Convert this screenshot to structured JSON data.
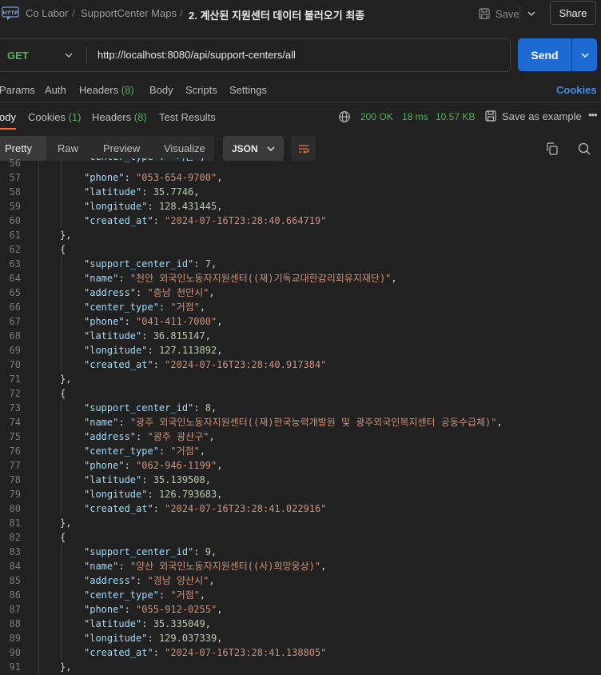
{
  "breadcrumb": {
    "workspace": "Co Labor",
    "collection": "SupportCenter Maps",
    "request": "2. 계산된 지원센터 데이터 불러오기 최종"
  },
  "header": {
    "save_label": "Save",
    "share_label": "Share"
  },
  "request": {
    "method": "GET",
    "url": "http://localhost:8080/api/support-centers/all",
    "send_label": "Send"
  },
  "request_tabs": {
    "params": "Params",
    "auth": "Auth",
    "headers": "Headers",
    "headers_count": "(8)",
    "body": "Body",
    "scripts": "Scripts",
    "settings": "Settings",
    "cookies": "Cookies"
  },
  "response_tabs": {
    "body": "ody",
    "cookies": "Cookies",
    "cookies_count": "(1)",
    "headers": "Headers",
    "headers_count": "(8)",
    "test_results": "Test Results"
  },
  "response_status": {
    "status": "200 OK",
    "time": "18 ms",
    "size": "10.57 KB",
    "save_example": "Save as example"
  },
  "format_tabs": {
    "pretty": "Pretty",
    "raw": "Raw",
    "preview": "Preview",
    "visualize": "Visualize",
    "format": "JSON"
  },
  "colors": {
    "accent": "#1d6ad3",
    "status_ok": "#53b25b",
    "tab_active": "#ff6c37",
    "cookies_link": "#3d8fe6"
  },
  "code_lines": [
    {
      "n": "56",
      "kind": "partial",
      "text": "\"center_type\": \"기관\","
    },
    {
      "n": "57",
      "kind": "kv",
      "key": "phone",
      "val": "\"053-654-9700\"",
      "vt": "s",
      "comma": ","
    },
    {
      "n": "58",
      "kind": "kv",
      "key": "latitude",
      "val": "35.7746",
      "vt": "n",
      "comma": ","
    },
    {
      "n": "59",
      "kind": "kv",
      "key": "longitude",
      "val": "128.431445",
      "vt": "n",
      "comma": ","
    },
    {
      "n": "60",
      "kind": "kv",
      "key": "created_at",
      "val": "\"2024-07-16T23:28:40.664719\"",
      "vt": "s",
      "comma": ""
    },
    {
      "n": "61",
      "kind": "close",
      "text": "},"
    },
    {
      "n": "62",
      "kind": "open",
      "text": "{"
    },
    {
      "n": "63",
      "kind": "kv",
      "key": "support_center_id",
      "val": "7",
      "vt": "n",
      "comma": ","
    },
    {
      "n": "64",
      "kind": "kv",
      "key": "name",
      "val": "\"천안 외국인노동자지원센터((재)기독교대한감리회유지재단)\"",
      "vt": "s",
      "comma": ","
    },
    {
      "n": "65",
      "kind": "kv",
      "key": "address",
      "val": "\"충남 천안시\"",
      "vt": "s",
      "comma": ","
    },
    {
      "n": "66",
      "kind": "kv",
      "key": "center_type",
      "val": "\"거점\"",
      "vt": "s",
      "comma": ","
    },
    {
      "n": "67",
      "kind": "kv",
      "key": "phone",
      "val": "\"041-411-7000\"",
      "vt": "s",
      "comma": ","
    },
    {
      "n": "68",
      "kind": "kv",
      "key": "latitude",
      "val": "36.815147",
      "vt": "n",
      "comma": ","
    },
    {
      "n": "69",
      "kind": "kv",
      "key": "longitude",
      "val": "127.113892",
      "vt": "n",
      "comma": ","
    },
    {
      "n": "70",
      "kind": "kv",
      "key": "created_at",
      "val": "\"2024-07-16T23:28:40.917384\"",
      "vt": "s",
      "comma": ""
    },
    {
      "n": "71",
      "kind": "close",
      "text": "},"
    },
    {
      "n": "72",
      "kind": "open",
      "text": "{"
    },
    {
      "n": "73",
      "kind": "kv",
      "key": "support_center_id",
      "val": "8",
      "vt": "n",
      "comma": ","
    },
    {
      "n": "74",
      "kind": "kv",
      "key": "name",
      "val": "\"광주 외국인노동자지원센터((재)한국능력개발원 및 광주외국인복지센터 공동수급체)\"",
      "vt": "s",
      "comma": ","
    },
    {
      "n": "75",
      "kind": "kv",
      "key": "address",
      "val": "\"광주 광산구\"",
      "vt": "s",
      "comma": ","
    },
    {
      "n": "76",
      "kind": "kv",
      "key": "center_type",
      "val": "\"거점\"",
      "vt": "s",
      "comma": ","
    },
    {
      "n": "77",
      "kind": "kv",
      "key": "phone",
      "val": "\"062-946-1199\"",
      "vt": "s",
      "comma": ","
    },
    {
      "n": "78",
      "kind": "kv",
      "key": "latitude",
      "val": "35.139508",
      "vt": "n",
      "comma": ","
    },
    {
      "n": "79",
      "kind": "kv",
      "key": "longitude",
      "val": "126.793683",
      "vt": "n",
      "comma": ","
    },
    {
      "n": "80",
      "kind": "kv",
      "key": "created_at",
      "val": "\"2024-07-16T23:28:41.022916\"",
      "vt": "s",
      "comma": ""
    },
    {
      "n": "81",
      "kind": "close",
      "text": "},"
    },
    {
      "n": "82",
      "kind": "open",
      "text": "{"
    },
    {
      "n": "83",
      "kind": "kv",
      "key": "support_center_id",
      "val": "9",
      "vt": "n",
      "comma": ","
    },
    {
      "n": "84",
      "kind": "kv",
      "key": "name",
      "val": "\"양산 외국인노동자지원센터((사)희망웅상)\"",
      "vt": "s",
      "comma": ","
    },
    {
      "n": "85",
      "kind": "kv",
      "key": "address",
      "val": "\"경남 양산시\"",
      "vt": "s",
      "comma": ","
    },
    {
      "n": "86",
      "kind": "kv",
      "key": "center_type",
      "val": "\"거점\"",
      "vt": "s",
      "comma": ","
    },
    {
      "n": "87",
      "kind": "kv",
      "key": "phone",
      "val": "\"055-912-0255\"",
      "vt": "s",
      "comma": ","
    },
    {
      "n": "88",
      "kind": "kv",
      "key": "latitude",
      "val": "35.335049",
      "vt": "n",
      "comma": ","
    },
    {
      "n": "89",
      "kind": "kv",
      "key": "longitude",
      "val": "129.037339",
      "vt": "n",
      "comma": ","
    },
    {
      "n": "90",
      "kind": "kv",
      "key": "created_at",
      "val": "\"2024-07-16T23:28:41.138805\"",
      "vt": "s",
      "comma": ""
    },
    {
      "n": "91",
      "kind": "close",
      "text": "},"
    }
  ]
}
